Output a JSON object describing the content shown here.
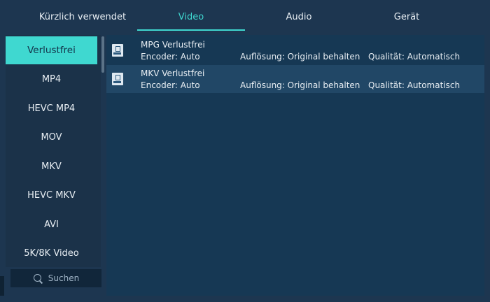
{
  "tabs": [
    {
      "label": "Kürzlich verwendet",
      "active": false
    },
    {
      "label": "Video",
      "active": true
    },
    {
      "label": "Audio",
      "active": false
    },
    {
      "label": "Gerät",
      "active": false
    }
  ],
  "sidebar": {
    "items": [
      {
        "label": "Verlustfrei",
        "active": true
      },
      {
        "label": "MP4"
      },
      {
        "label": "HEVC MP4"
      },
      {
        "label": "MOV"
      },
      {
        "label": "MKV"
      },
      {
        "label": "HEVC MKV"
      },
      {
        "label": "AVI"
      },
      {
        "label": "5K/8K Video"
      }
    ],
    "search_label": "Suchen"
  },
  "formats": [
    {
      "name": "MPG Verlustfrei",
      "encoder": "Encoder: Auto",
      "resolution": "Auflösung: Original behalten",
      "quality": "Qualität: Automatisch",
      "icon": "mpg-file-icon"
    },
    {
      "name": "MKV Verlustfrei",
      "encoder": "Encoder: Auto",
      "resolution": "Auflösung: Original behalten",
      "quality": "Qualität: Automatisch",
      "icon": "mkv-file-icon"
    }
  ],
  "colors": {
    "accent": "#3fd8d0",
    "background": "#1d3650",
    "panel": "#163854"
  }
}
